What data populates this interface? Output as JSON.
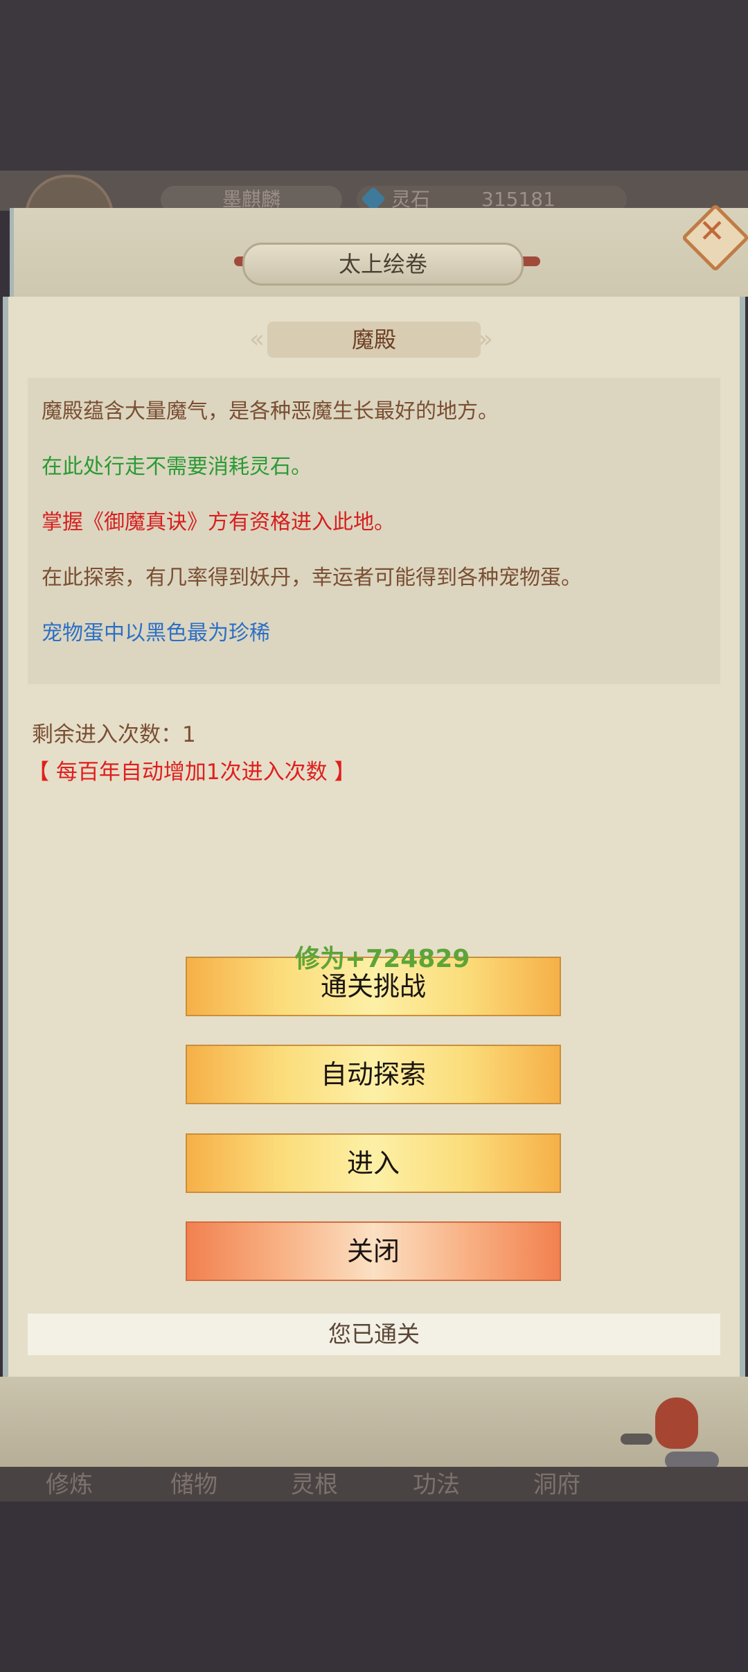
{
  "hud": {
    "player_name": "墨麒麟",
    "currency_label": "灵石",
    "currency_value": "315181"
  },
  "window": {
    "title": "太上绘卷",
    "close_icon": "close-x-icon"
  },
  "section": {
    "title": "魔殿",
    "descriptions": [
      {
        "text": "魔殿蕴含大量魔气，是各种恶魔生长最好的地方。",
        "color": "#7a4e33"
      },
      {
        "text": "在此处行走不需要消耗灵石。",
        "color": "#2a9a34"
      },
      {
        "text": "掌握《御魔真诀》方有资格进入此地。",
        "color": "#d61f1f"
      },
      {
        "text": "在此探索，有几率得到妖丹，幸运者可能得到各种宠物蛋。",
        "color": "#7a4e33"
      },
      {
        "text": "宠物蛋中以黑色最为珍稀",
        "color": "#2d6fc6"
      }
    ],
    "remaining_label": "剩余进入次数：1",
    "auto_increase_note": "【 每百年自动增加1次进入次数 】"
  },
  "floating_text": "修为+724829",
  "buttons": {
    "challenge": "通关挑战",
    "auto_explore": "自动探索",
    "enter": "进入",
    "close": "关闭"
  },
  "status": "您已通关",
  "bottom_nav": [
    "修炼",
    "储物",
    "灵根",
    "功法",
    "洞府"
  ]
}
